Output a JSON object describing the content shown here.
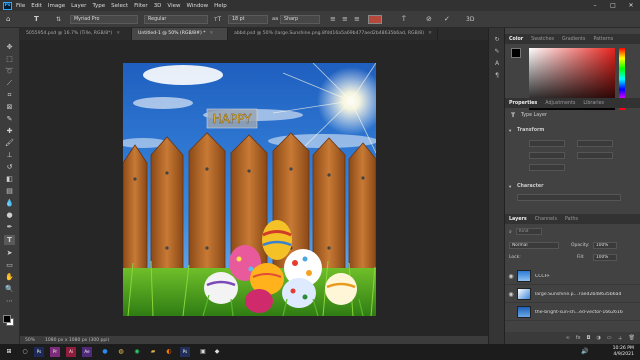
{
  "menu": {
    "logo": "Ps",
    "items": [
      "File",
      "Edit",
      "Image",
      "Layer",
      "Type",
      "Select",
      "Filter",
      "3D",
      "View",
      "Window",
      "Help"
    ]
  },
  "window_controls": {
    "minimize": "–",
    "maximize": "□",
    "close": "✕"
  },
  "options_bar": {
    "font_family": "Myriad Pro",
    "font_style": "Regular",
    "font_size": "18 pt",
    "antialias": "Sharp",
    "text_color": "#b4483a"
  },
  "doc_tabs": [
    {
      "label": "5055954.psd @ 16.7% (Tille, RGB/8*)",
      "active": false
    },
    {
      "label": "Untitled-1 @ 50% (RGB/8#) *",
      "active": true
    },
    {
      "label": "abbd.psd @ 50% (large.Sunshine.png.8fdd16a5a69b477aed2b48635b6ad, RGB/8)",
      "active": false
    }
  ],
  "canvas": {
    "text": "HAPPY"
  },
  "status": {
    "zoom": "50%",
    "doc_size": "1080 px x 1080 px (300 ppi)"
  },
  "color_panel": {
    "tabs": [
      "Color",
      "Swatches",
      "Gradients",
      "Patterns"
    ]
  },
  "properties_panel": {
    "tabs": [
      "Properties",
      "Adjustments",
      "Libraries"
    ],
    "layer_type": "Type Layer",
    "transform_label": "Transform",
    "character_label": "Character"
  },
  "layers_panel": {
    "tabs": [
      "Layers",
      "Channels",
      "Paths"
    ],
    "kind": "Kind",
    "blend": "Normal",
    "opacity_label": "Opacity:",
    "opacity": "100%",
    "lock_label": "Lock:",
    "fill_label": "Fill:",
    "fill": "100%",
    "layers": [
      {
        "name": "CCCFF",
        "visible": true
      },
      {
        "name": "large.Sunshine.p...7aed2b48635b6ad",
        "visible": true
      },
      {
        "name": "the-bright-sun-sh...ed-vector-1662616",
        "visible": false
      }
    ]
  },
  "taskbar": {
    "time": "10:26 PM",
    "date": "4/9/2021"
  }
}
